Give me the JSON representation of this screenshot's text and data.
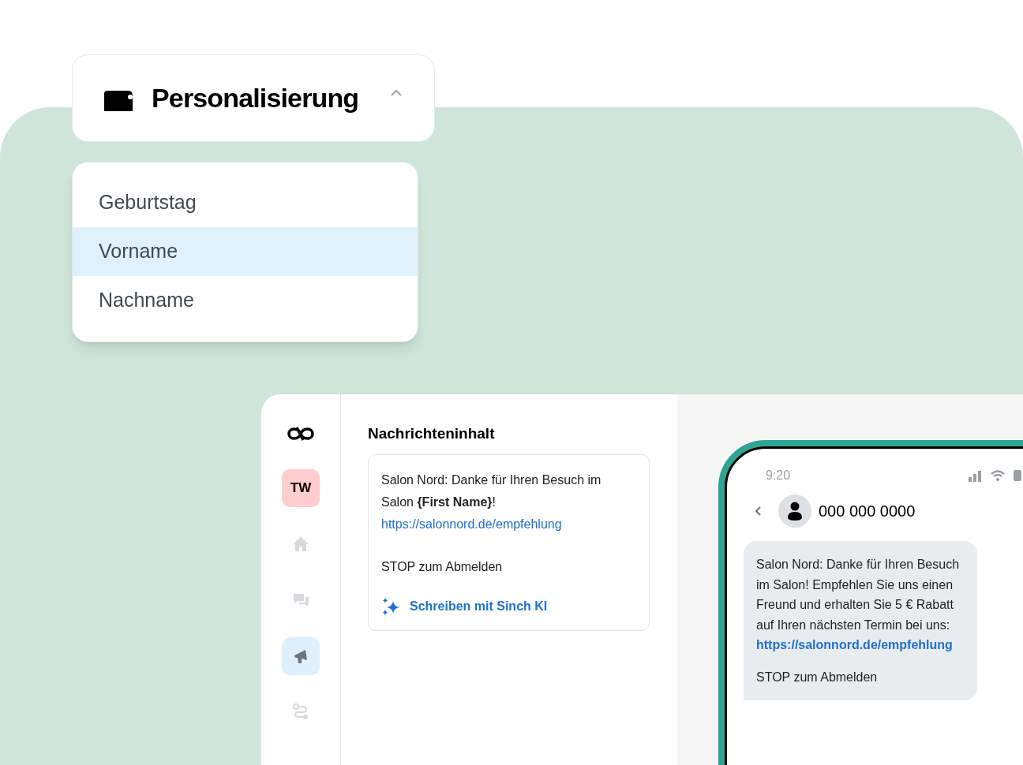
{
  "dropdown": {
    "title": "Personalisierung",
    "expanded": true
  },
  "options": [
    {
      "label": "Geburtstag",
      "selected": false
    },
    {
      "label": "Vorname",
      "selected": true
    },
    {
      "label": "Nachname",
      "selected": false
    }
  ],
  "sidebar": {
    "avatar": "TW",
    "items": [
      {
        "kind": "home",
        "selected": false
      },
      {
        "kind": "chat",
        "selected": false
      },
      {
        "kind": "megaphone",
        "selected": true
      },
      {
        "kind": "route",
        "selected": false
      }
    ]
  },
  "editor": {
    "heading": "Nachrichteninhalt",
    "text": "Salon Nord: Danke für Ihren Besuch im Salon **{First Name}**!",
    "link": "https://salonnord.de/empfehlung",
    "footer": "STOP zum Abmelden",
    "ai_button": "Schreiben mit Sinch KI"
  },
  "phone": {
    "time": "9:20",
    "contact": "000 000 0000",
    "bubble_text": "Salon Nord: Danke für Ihren Besuch im Salon! Empfehlen Sie uns einen Freund und erhalten Sie 5 € Rabatt auf Ihren nächsten Termin bei uns:",
    "bubble_link": "https://salonnord.de/empfehlung",
    "bubble_footer": "STOP zum Abmelden"
  }
}
